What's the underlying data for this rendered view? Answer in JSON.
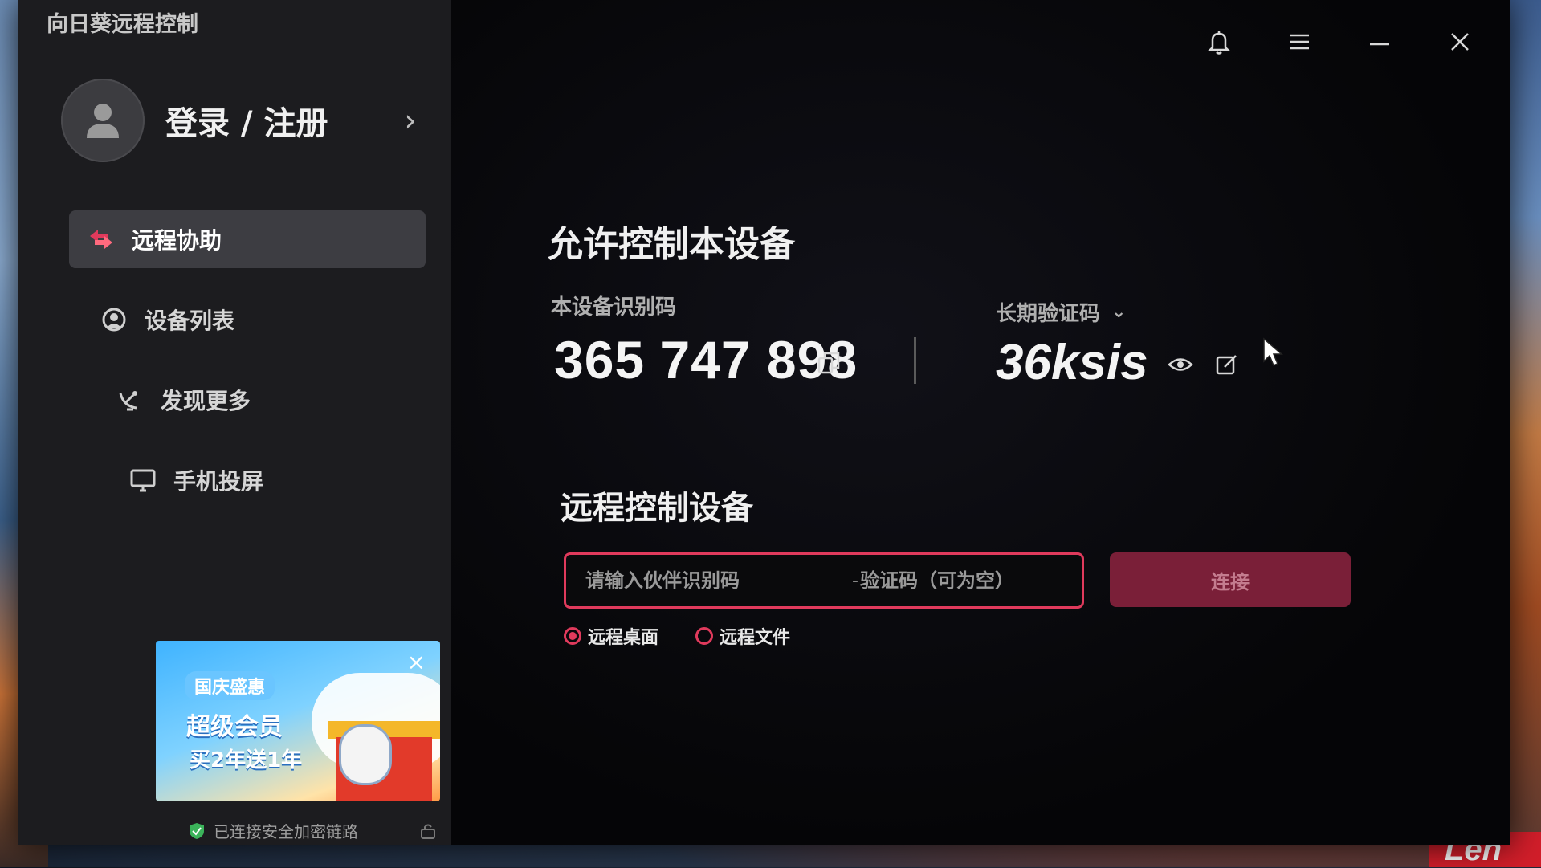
{
  "app": {
    "title": "向日葵远程控制"
  },
  "profile": {
    "label": "登录 / 注册",
    "arrow": "›"
  },
  "nav": {
    "items": [
      {
        "label": "远程协助",
        "icon": "remote-assist-icon",
        "active": true
      },
      {
        "label": "设备列表",
        "icon": "device-list-icon",
        "active": false
      },
      {
        "label": "发现更多",
        "icon": "discover-icon",
        "active": false
      },
      {
        "label": "手机投屏",
        "icon": "screen-cast-icon",
        "active": false
      }
    ]
  },
  "promo": {
    "tag": "国庆盛惠",
    "headline": "超级会员",
    "subline": "买2年送1年",
    "close": "×"
  },
  "footer": {
    "secure_text": "已连接安全加密链路"
  },
  "allow_section": {
    "title": "允许控制本设备",
    "id_label": "本设备识别码",
    "device_id": "365 747 898",
    "code_type": "长期验证码",
    "code_chevron": "⌄",
    "verify_code": "36ksis"
  },
  "remote_section": {
    "title": "远程控制设备",
    "partner_placeholder": "请输入伙伴识别码",
    "separator": "-",
    "code_placeholder": "验证码（可为空）",
    "connect_label": "连接",
    "modes": [
      {
        "label": "远程桌面",
        "selected": true
      },
      {
        "label": "远程文件",
        "selected": false
      }
    ]
  },
  "colors": {
    "accent": "#e03a5c",
    "connect_bg": "#7a1f38",
    "sidebar_bg": "#1c1c1f",
    "active_item_bg": "#3d3d42"
  },
  "brand": {
    "text": "Len"
  }
}
